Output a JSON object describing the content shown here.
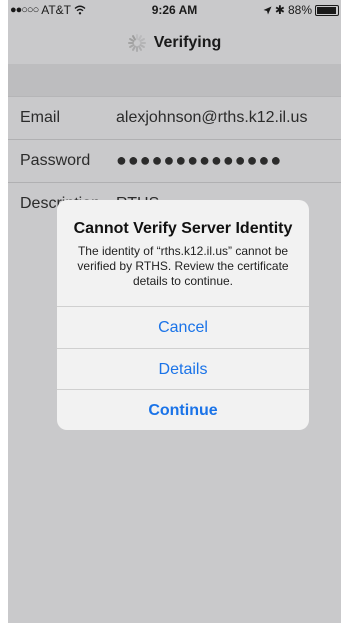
{
  "status_bar": {
    "signal": "●●○○○",
    "carrier": "AT&T",
    "wifi_icon": "wifi-icon",
    "time": "9:26 AM",
    "battery_text": "88%",
    "battery_level": 0.88
  },
  "navbar": {
    "title": "Verifying"
  },
  "form": {
    "email_label": "Email",
    "email_value": "alexjohnson@rths.k12.il.us",
    "password_label": "Password",
    "password_value": "●●●●●●●●●●●●●●",
    "description_label": "Description",
    "description_value": "RTHS"
  },
  "alert": {
    "title": "Cannot Verify Server Identity",
    "message": "The identity of “rths.k12.il.us” cannot be verified by RTHS. Review the certificate details to continue.",
    "cancel_label": "Cancel",
    "details_label": "Details",
    "continue_label": "Continue"
  },
  "colors": {
    "dim_background": "#c9c9cb",
    "alert_background": "#f2f2f2",
    "button_text": "#1a73e8"
  }
}
